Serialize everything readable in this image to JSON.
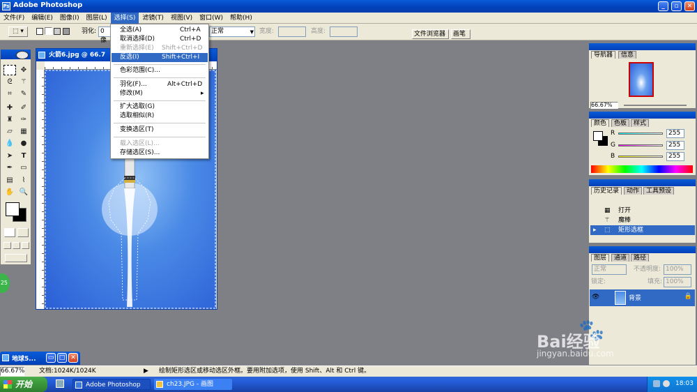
{
  "app": {
    "title": "Adobe Photoshop"
  },
  "menubar": [
    "文件(F)",
    "编辑(E)",
    "图像(I)",
    "图层(L)",
    "选择(S)",
    "滤镜(T)",
    "视图(V)",
    "窗口(W)",
    "帮助(H)"
  ],
  "options": {
    "feather_label": "羽化:",
    "feather_value": "0 像",
    "style_value": "正常",
    "width_label": "宽度:",
    "height_label": "高度:",
    "tab_file_browser": "文件浏览器",
    "tab_brushes": "画笔"
  },
  "select_menu": {
    "items": [
      {
        "label": "全选(A)",
        "shortcut": "Ctrl+A"
      },
      {
        "label": "取消选择(D)",
        "shortcut": "Ctrl+D"
      },
      {
        "label": "重新选择(E)",
        "shortcut": "Shift+Ctrl+D"
      },
      {
        "label": "反选(I)",
        "shortcut": "Shift+Ctrl+I"
      },
      {
        "label": "色彩范围(C)..."
      },
      {
        "label": "羽化(F)...",
        "shortcut": "Alt+Ctrl+D"
      },
      {
        "label": "修改(M)",
        "submenu": "▸"
      },
      {
        "label": "扩大选取(G)"
      },
      {
        "label": "选取相似(R)"
      },
      {
        "label": "变换选区(T)"
      },
      {
        "label": "载入选区(L)..."
      },
      {
        "label": "存储选区(S)..."
      }
    ]
  },
  "document": {
    "title": "火箭6.jpg @ 66.7"
  },
  "minimized_doc": {
    "title": "地球5..."
  },
  "navigator": {
    "tabs": [
      "导航器",
      "信息"
    ],
    "zoom": "66.67%"
  },
  "color": {
    "tabs": [
      "颜色",
      "色板",
      "样式"
    ],
    "r": "255",
    "g": "255",
    "b": "255",
    "r_label": "R",
    "g_label": "G",
    "b_label": "B"
  },
  "history": {
    "tabs": [
      "历史记录",
      "动作",
      "工具预设"
    ],
    "items": [
      "打开",
      "魔棒",
      "矩形选框"
    ]
  },
  "layers": {
    "tabs": [
      "图层",
      "通道",
      "路径"
    ],
    "blend": "正常",
    "opacity_label": "不透明度:",
    "opacity": "100%",
    "lock_label": "锁定:",
    "fill_label": "填充:",
    "fill": "100%",
    "layer_name": "背景"
  },
  "status": {
    "zoom": "66.67%",
    "doc_size": "文档:1024K/1024K",
    "hint": "绘制矩形选区或移动选区外框。要用附加选项，使用 Shift、Alt 和 Ctrl 键。"
  },
  "taskbar": {
    "start": "开始",
    "tasks": [
      "Adobe Photoshop",
      "ch23.JPG - 画图"
    ],
    "time": "18:03"
  },
  "badge": {
    "value": "25"
  },
  "watermark": {
    "brand": "Bai经验",
    "url": "jingyan.baidu.com"
  },
  "colors": {
    "xp_blue": "#0a5bd8",
    "menu_highlight": "#316ac5",
    "start_green": "#3c9a3c"
  }
}
